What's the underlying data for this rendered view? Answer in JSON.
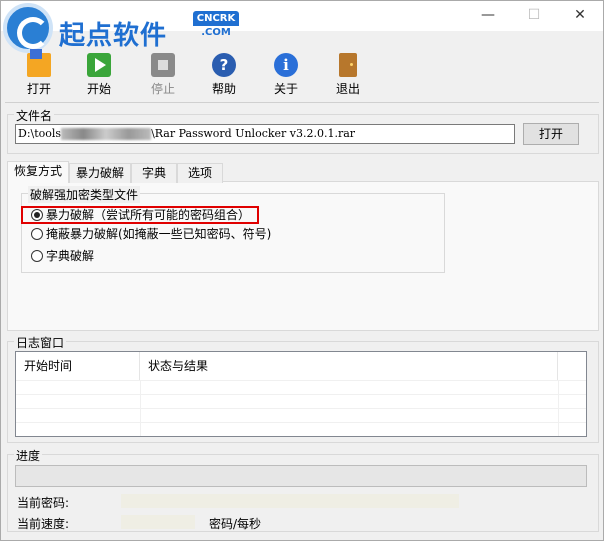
{
  "window": {
    "logo_text": "起点软件",
    "logo_badge_top": "CNCRK",
    "logo_badge_bottom": ".COM",
    "minimize": "—",
    "maximize": "☐",
    "close": "✕"
  },
  "toolbar": {
    "open": "打开",
    "start": "开始",
    "stop": "停止",
    "help": "帮助",
    "about": "关于",
    "exit": "退出"
  },
  "file": {
    "group_title": "文件名",
    "path_prefix": "D:\\tools",
    "path_suffix": "\\Rar Password Unlocker v3.2.0.1.rar",
    "open_button": "打开"
  },
  "tabs": [
    "恢复方式",
    "暴力破解",
    "字典",
    "选项"
  ],
  "recovery": {
    "group_title": "破解强加密类型文件",
    "options": [
      {
        "label": "暴力破解（尝试所有可能的密码组合）",
        "selected": true
      },
      {
        "label": "掩蔽暴力破解(如掩蔽一些已知密码、符号)",
        "selected": false
      },
      {
        "label": "字典破解",
        "selected": false
      }
    ]
  },
  "log": {
    "group_title": "日志窗口",
    "columns": [
      "开始时间",
      "状态与结果"
    ]
  },
  "progress": {
    "group_title": "进度",
    "current_password_label": "当前密码:",
    "current_speed_label": "当前速度:",
    "speed_unit": "密码/每秒"
  }
}
